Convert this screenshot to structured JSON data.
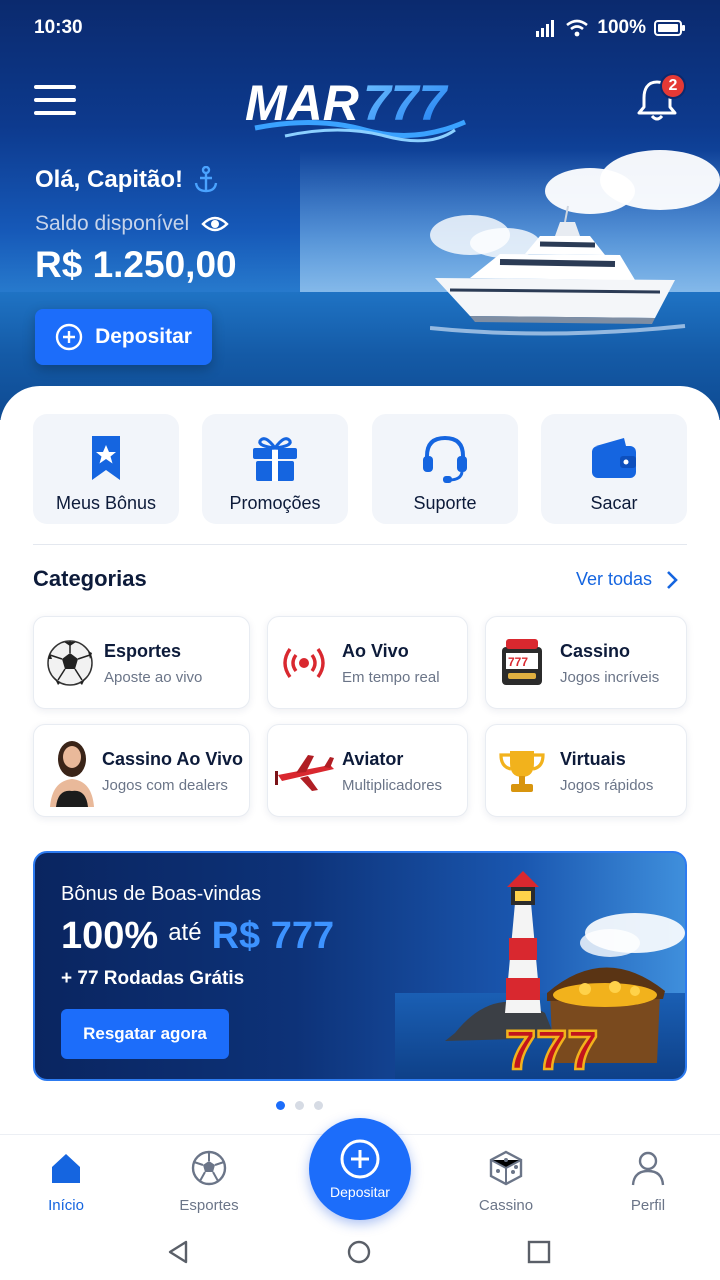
{
  "status_bar": {
    "time": "10:30",
    "battery": "100%"
  },
  "header": {
    "logo_text": "MAR777",
    "notifications_count": "2"
  },
  "hero": {
    "greeting": "Olá, Capitão!",
    "balance_label": "Saldo disponível",
    "balance": "R$ 1.250,00",
    "deposit_label": "Depositar"
  },
  "quick_actions": [
    {
      "label": "Meus Bônus",
      "icon": "bonus-badge-icon"
    },
    {
      "label": "Promoções",
      "icon": "gift-icon"
    },
    {
      "label": "Suporte",
      "icon": "headset-icon"
    },
    {
      "label": "Sacar",
      "icon": "wallet-icon"
    }
  ],
  "categories": {
    "title": "Categorias",
    "see_all": "Ver todas",
    "items": [
      {
        "title": "Esportes",
        "subtitle": "Aposte ao vivo",
        "icon": "soccer-ball-icon"
      },
      {
        "title": "Ao Vivo",
        "subtitle": "Em tempo real",
        "icon": "live-broadcast-icon"
      },
      {
        "title": "Cassino",
        "subtitle": "Jogos incríveis",
        "icon": "slot-machine-icon"
      },
      {
        "title": "Cassino Ao Vivo",
        "subtitle": "Jogos com dealers",
        "icon": "dealer-icon"
      },
      {
        "title": "Aviator",
        "subtitle": "Multiplicadores",
        "icon": "airplane-icon"
      },
      {
        "title": "Virtuais",
        "subtitle": "Jogos rápidos",
        "icon": "trophy-icon"
      }
    ]
  },
  "promo": {
    "title": "Bônus de Boas-vindas",
    "percent": "100%",
    "connector": "até",
    "amount": "R$ 777",
    "extra": "+ 77 Rodadas Grátis",
    "button": "Resgatar agora",
    "art_text": "777"
  },
  "bottom_nav": {
    "home": "Início",
    "sports": "Esportes",
    "deposit": "Depositar",
    "casino": "Cassino",
    "profile": "Perfil"
  },
  "colors": {
    "accent": "#1c6dfa",
    "hero_dark": "#0b2a6e",
    "text_dark": "#0d1b3a",
    "badge": "#e53935"
  }
}
